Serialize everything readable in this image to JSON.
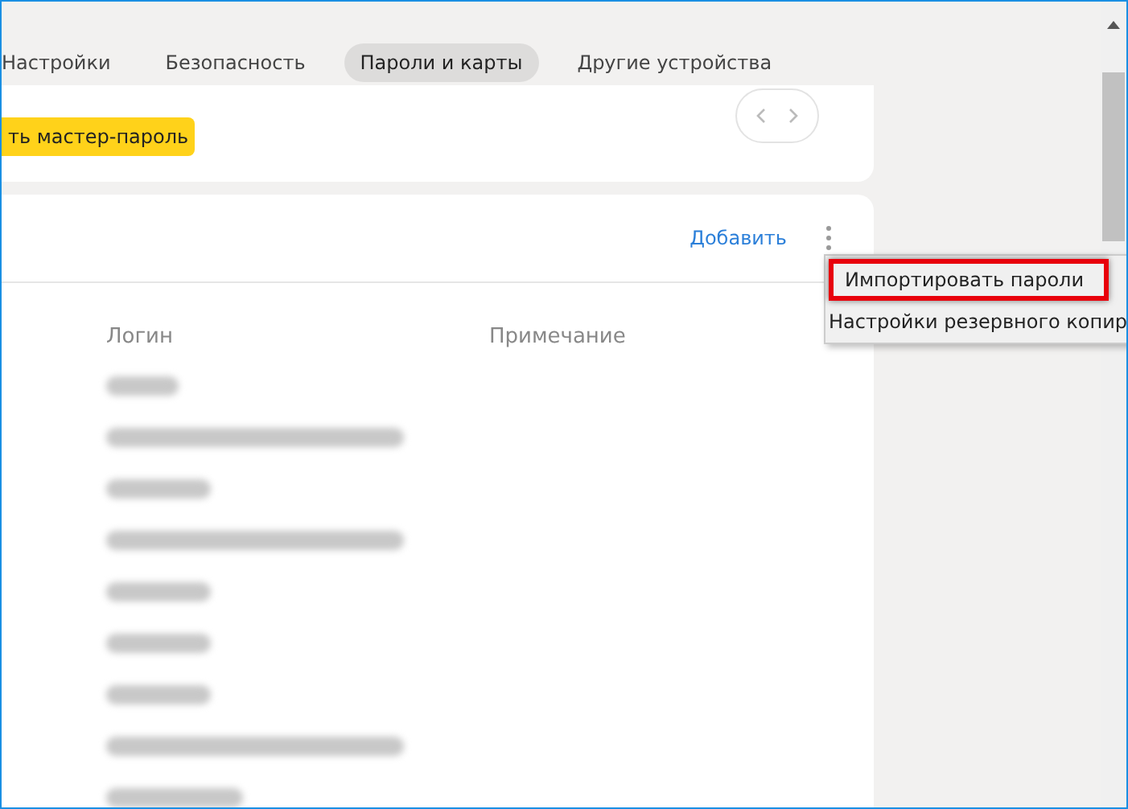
{
  "tabs": [
    {
      "label": "Настройки",
      "selected": false
    },
    {
      "label": "Безопасность",
      "selected": false
    },
    {
      "label": "Пароли и карты",
      "selected": true
    },
    {
      "label": "Другие устройства",
      "selected": false
    }
  ],
  "master_password_button": {
    "label": "ть мастер-пароль"
  },
  "passwords": {
    "add_link": "Добавить",
    "columns": [
      "Логин",
      "Примечание"
    ]
  },
  "menu": {
    "items": [
      {
        "label": "Импортировать пароли",
        "selected": true
      },
      {
        "label": "Настройки резервного копир",
        "selected": false
      }
    ]
  }
}
